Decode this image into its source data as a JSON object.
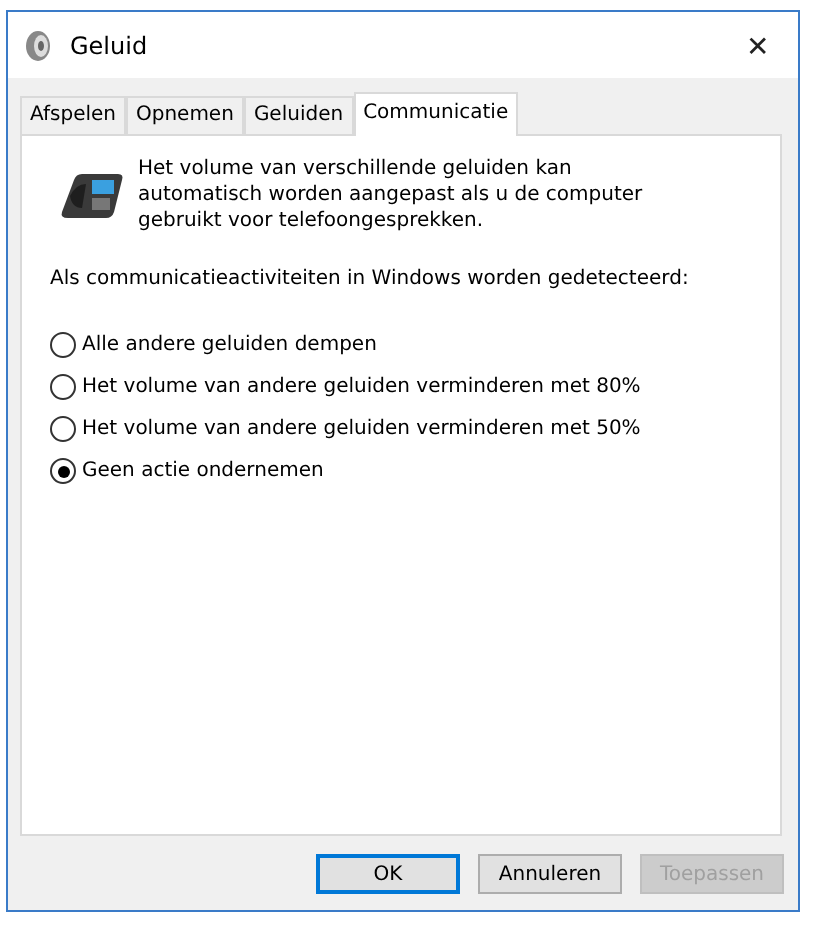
{
  "window": {
    "title": "Geluid",
    "close": "✕"
  },
  "tabs": [
    {
      "label": "Afspelen",
      "selected": false
    },
    {
      "label": "Opnemen",
      "selected": false
    },
    {
      "label": "Geluiden",
      "selected": false
    },
    {
      "label": "Communicatie",
      "selected": true
    }
  ],
  "description": "Het volume van verschillende geluiden kan automatisch worden aangepast als u de computer gebruikt voor telefoongesprekken.",
  "prompt": "Als communicatieactiviteiten in Windows worden gedetecteerd:",
  "options": [
    {
      "label": "Alle andere geluiden dempen",
      "selected": false
    },
    {
      "label": "Het volume van andere geluiden verminderen met 80%",
      "selected": false
    },
    {
      "label": "Het volume van andere geluiden verminderen met 50%",
      "selected": false
    },
    {
      "label": "Geen actie ondernemen",
      "selected": true
    }
  ],
  "buttons": [
    {
      "label": "OK",
      "default": true,
      "disabled": false
    },
    {
      "label": "Annuleren",
      "default": false,
      "disabled": false
    },
    {
      "label": "Toepassen",
      "default": false,
      "disabled": true
    }
  ]
}
